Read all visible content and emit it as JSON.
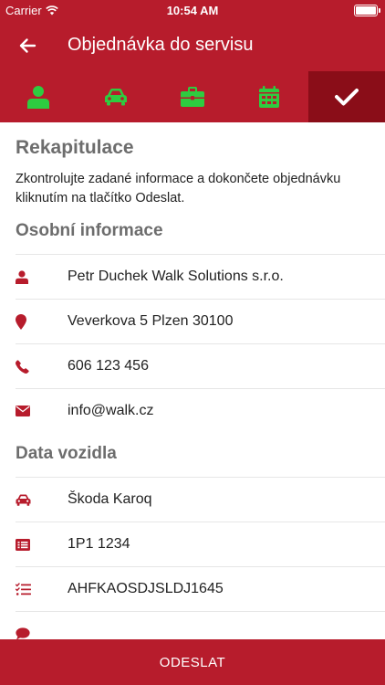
{
  "status_bar": {
    "carrier": "Carrier",
    "time": "10:54 AM"
  },
  "app_bar": {
    "title": "Objednávka do servisu",
    "back_icon": "arrow-left-icon"
  },
  "steps": [
    {
      "icon": "user-icon",
      "state": "complete"
    },
    {
      "icon": "car-icon",
      "state": "complete"
    },
    {
      "icon": "toolbox-icon",
      "state": "complete"
    },
    {
      "icon": "calendar-icon",
      "state": "complete"
    },
    {
      "icon": "check-icon",
      "state": "current"
    }
  ],
  "summary": {
    "title": "Rekapitulace",
    "text": "Zkontrolujte zadané informace a dokončete objednávku kliknutím na tlačítko Odeslat."
  },
  "personal": {
    "title": "Osobní informace",
    "name": "Petr Duchek Walk Solutions s.r.o.",
    "address": "Veverkova 5 Plzen 30100",
    "phone": "606 123 456",
    "email": "info@walk.cz"
  },
  "vehicle": {
    "title": "Data vozidla",
    "model": "Škoda Karoq",
    "plate": "1P1 1234",
    "vin": "AHFKAOSDJSLDJ1645"
  },
  "submit_label": "ODESLAT",
  "colors": {
    "primary": "#b71c2c",
    "step_done": "#8a0d18",
    "step_complete_icon": "#2ecc40",
    "heading": "#6d6d6d"
  }
}
